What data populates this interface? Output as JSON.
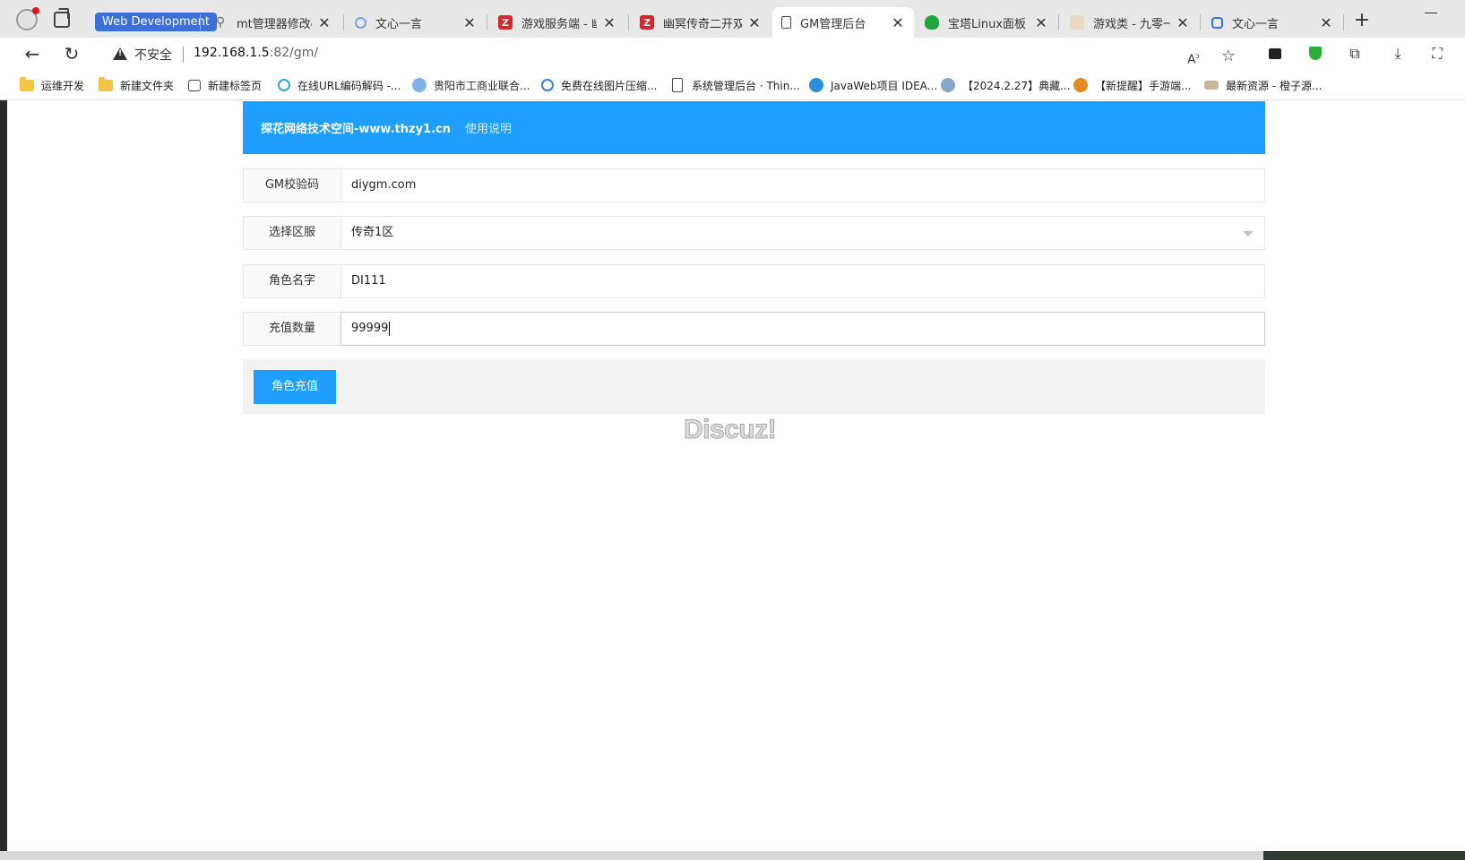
{
  "browser": {
    "tab_group_label": "Web Development",
    "tabs": [
      {
        "label": "mt管理器修改dll -",
        "icon": "search-icon",
        "active": false
      },
      {
        "label": "文心一言",
        "icon": "wenxin-icon",
        "active": false
      },
      {
        "label": "游戏服务端 - 幽冥",
        "icon": "z-logo-icon",
        "active": false
      },
      {
        "label": "幽冥传奇二开双端",
        "icon": "z-logo-icon",
        "active": false
      },
      {
        "label": "GM管理后台",
        "icon": "page-icon",
        "active": true
      },
      {
        "label": "宝塔Linux面板",
        "icon": "baota-icon",
        "active": false
      },
      {
        "label": "游戏类 - 九零一起",
        "icon": "site-icon",
        "active": false
      },
      {
        "label": "文心一言",
        "icon": "wenxin-icon",
        "active": false
      }
    ],
    "address": {
      "security_label": "不安全",
      "url_host": "192.168.1.5",
      "url_rest": ":82/gm/"
    },
    "bookmarks": [
      {
        "label": "运维开发",
        "icon": "folder-icon"
      },
      {
        "label": "新建文件夹",
        "icon": "folder-icon"
      },
      {
        "label": "新建标签页",
        "icon": "newtab-icon"
      },
      {
        "label": "在线URL编码解码 -...",
        "icon": "link-icon"
      },
      {
        "label": "贵阳市工商业联合...",
        "icon": "globe-icon"
      },
      {
        "label": "免费在线图片压缩...",
        "icon": "compress-icon"
      },
      {
        "label": "系统管理后台 · Thin...",
        "icon": "page-icon"
      },
      {
        "label": "JavaWeb项目 IDEA...",
        "icon": "java-icon"
      },
      {
        "label": "【2024.2.27】典藏...",
        "icon": "site-icon"
      },
      {
        "label": "【新提醒】手游端...",
        "icon": "site-icon"
      },
      {
        "label": "最新资源 - 橙子源...",
        "icon": "site-icon"
      }
    ]
  },
  "page": {
    "header": {
      "title": "探花网络技术空间-www.thzy1.cn",
      "help_link": "使用说明"
    },
    "form": {
      "gm_code": {
        "label": "GM校验码",
        "value": "diygm.com"
      },
      "server": {
        "label": "选择区服",
        "value": "传奇1区"
      },
      "role_name": {
        "label": "角色名字",
        "value": "DI111"
      },
      "amount": {
        "label": "充值数量",
        "value": "99999"
      }
    },
    "submit_label": "角色充值",
    "watermark": "Discuz!"
  },
  "colors": {
    "primary": "#1e9fff",
    "tab_group": "#3c6fd8"
  }
}
